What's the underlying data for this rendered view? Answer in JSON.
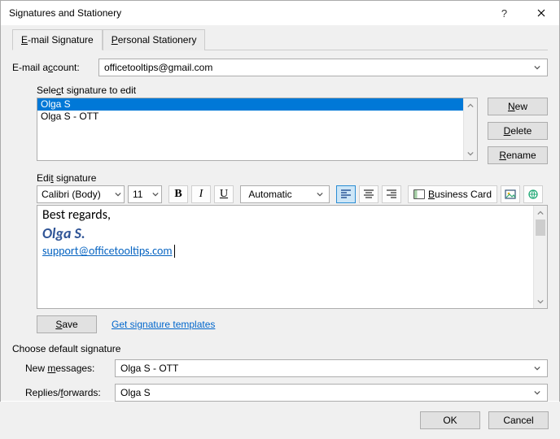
{
  "window": {
    "title": "Signatures and Stationery"
  },
  "tabs": {
    "email_signature": "E-mail Signature",
    "personal_stationery": "Personal Stationery"
  },
  "email_account": {
    "label": "E-mail account:",
    "value": "officetooltips@gmail.com"
  },
  "select_signature": {
    "label": "Select signature to edit",
    "items": [
      "Olga S",
      "Olga S - OTT"
    ],
    "selected_index": 0
  },
  "buttons": {
    "new": "New",
    "delete": "Delete",
    "rename": "Rename",
    "save": "Save",
    "ok": "OK",
    "cancel": "Cancel"
  },
  "edit_signature": {
    "label": "Edit signature",
    "font": "Calibri (Body)",
    "size": "11",
    "color_combo": "Automatic",
    "business_card": "Business Card",
    "body": {
      "line1": "Best regards,",
      "line2": "Olga S.",
      "line3": "support@officetooltips.com"
    }
  },
  "templates_link": "Get signature templates",
  "choose_default": {
    "heading": "Choose default signature",
    "new_messages_label": "New messages:",
    "new_messages_value": "Olga S - OTT",
    "replies_label": "Replies/forwards:",
    "replies_value": "Olga S"
  },
  "icons": {
    "help": "help-icon",
    "close": "close-icon",
    "chevron": "chevron-down-icon",
    "bold": "bold-icon",
    "italic": "italic-icon",
    "underline": "underline-icon",
    "align_left": "align-left-icon",
    "align_center": "align-center-icon",
    "align_right": "align-right-icon",
    "insert_picture": "insert-picture-icon",
    "insert_link": "insert-hyperlink-icon"
  }
}
